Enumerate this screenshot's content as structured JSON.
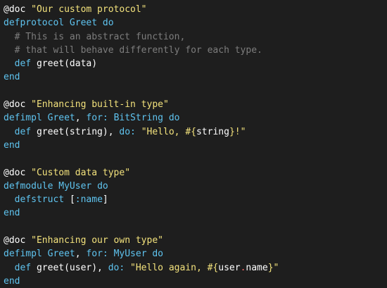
{
  "colors": {
    "background": "#1e1e1e",
    "keyword": "#5fc4f0",
    "string": "#f3e27c",
    "comment": "#7d7d7d",
    "plain": "#ffffff"
  },
  "code": {
    "lines": [
      [
        {
          "t": "attr",
          "v": "@doc "
        },
        {
          "t": "str",
          "v": "\"Our custom protocol\""
        }
      ],
      [
        {
          "t": "kw",
          "v": "defprotocol "
        },
        {
          "t": "kw",
          "v": "Greet "
        },
        {
          "t": "kw",
          "v": "do"
        }
      ],
      [
        {
          "t": "cm",
          "v": "  # This is an abstract function,"
        }
      ],
      [
        {
          "t": "cm",
          "v": "  # that will behave differently for each type."
        }
      ],
      [
        {
          "t": "plain",
          "v": "  "
        },
        {
          "t": "kw",
          "v": "def "
        },
        {
          "t": "plain",
          "v": "greet(data)"
        }
      ],
      [
        {
          "t": "kw",
          "v": "end"
        }
      ],
      [],
      [
        {
          "t": "attr",
          "v": "@doc "
        },
        {
          "t": "str",
          "v": "\"Enhancing built-in type\""
        }
      ],
      [
        {
          "t": "kw",
          "v": "defimpl "
        },
        {
          "t": "kw",
          "v": "Greet"
        },
        {
          "t": "plain",
          "v": ", "
        },
        {
          "t": "kw",
          "v": "for: "
        },
        {
          "t": "kw",
          "v": "BitString "
        },
        {
          "t": "kw",
          "v": "do"
        }
      ],
      [
        {
          "t": "plain",
          "v": "  "
        },
        {
          "t": "kw",
          "v": "def "
        },
        {
          "t": "plain",
          "v": "greet(string), "
        },
        {
          "t": "kw",
          "v": "do: "
        },
        {
          "t": "str",
          "v": "\"Hello, "
        },
        {
          "t": "str",
          "v": "#{"
        },
        {
          "t": "plain",
          "v": "string"
        },
        {
          "t": "str",
          "v": "}!\""
        }
      ],
      [
        {
          "t": "kw",
          "v": "end"
        }
      ],
      [],
      [
        {
          "t": "attr",
          "v": "@doc "
        },
        {
          "t": "str",
          "v": "\"Custom data type\""
        }
      ],
      [
        {
          "t": "kw",
          "v": "defmodule "
        },
        {
          "t": "kw",
          "v": "MyUser "
        },
        {
          "t": "kw",
          "v": "do"
        }
      ],
      [
        {
          "t": "plain",
          "v": "  "
        },
        {
          "t": "kw",
          "v": "defstruct "
        },
        {
          "t": "plain",
          "v": "["
        },
        {
          "t": "kw",
          "v": ":name"
        },
        {
          "t": "plain",
          "v": "]"
        }
      ],
      [
        {
          "t": "kw",
          "v": "end"
        }
      ],
      [],
      [
        {
          "t": "attr",
          "v": "@doc "
        },
        {
          "t": "str",
          "v": "\"Enhancing our own type\""
        }
      ],
      [
        {
          "t": "kw",
          "v": "defimpl "
        },
        {
          "t": "kw",
          "v": "Greet"
        },
        {
          "t": "plain",
          "v": ", "
        },
        {
          "t": "kw",
          "v": "for: "
        },
        {
          "t": "kw",
          "v": "MyUser "
        },
        {
          "t": "kw",
          "v": "do"
        }
      ],
      [
        {
          "t": "plain",
          "v": "  "
        },
        {
          "t": "kw",
          "v": "def "
        },
        {
          "t": "plain",
          "v": "greet(user), "
        },
        {
          "t": "kw",
          "v": "do: "
        },
        {
          "t": "str",
          "v": "\"Hello again, "
        },
        {
          "t": "str",
          "v": "#{"
        },
        {
          "t": "plain",
          "v": "user"
        },
        {
          "t": "dot",
          "v": "."
        },
        {
          "t": "plain",
          "v": "name"
        },
        {
          "t": "str",
          "v": "}\""
        }
      ],
      [
        {
          "t": "kw",
          "v": "end"
        }
      ]
    ]
  }
}
